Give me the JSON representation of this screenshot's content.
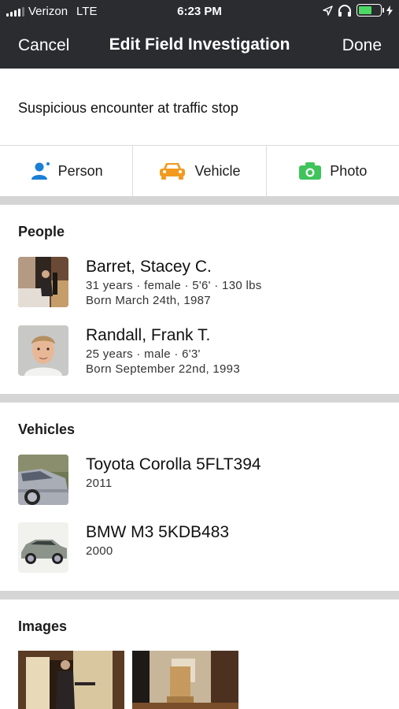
{
  "status_bar": {
    "carrier": "Verizon",
    "network": "LTE",
    "time": "6:23 PM",
    "battery_level": 0.6,
    "colors": {
      "battery": "#4cd964"
    }
  },
  "nav": {
    "cancel_label": "Cancel",
    "title": "Edit Field Investigation",
    "done_label": "Done"
  },
  "description": "Suspicious encounter at traffic stop",
  "add_actions": [
    {
      "label": "Person",
      "icon": "person-add-icon",
      "color": "#1a7fd6"
    },
    {
      "label": "Vehicle",
      "icon": "car-icon",
      "color": "#f29a1e"
    },
    {
      "label": "Photo",
      "icon": "camera-icon",
      "color": "#3fc45b"
    }
  ],
  "people": {
    "title": "People",
    "items": [
      {
        "name": "Barret, Stacey C.",
        "details": "31 years · female · 5'6' · 130 lbs",
        "born": "Born March 24th, 1987"
      },
      {
        "name": "Randall, Frank T.",
        "details": "25 years · male · 6'3'",
        "born": "Born September 22nd, 1993"
      }
    ]
  },
  "vehicles": {
    "title": "Vehicles",
    "items": [
      {
        "name": "Toyota Corolla 5FLT394",
        "year": "2011"
      },
      {
        "name": "BMW M3 5KDB483",
        "year": "2000"
      }
    ]
  },
  "images": {
    "title": "Images"
  }
}
